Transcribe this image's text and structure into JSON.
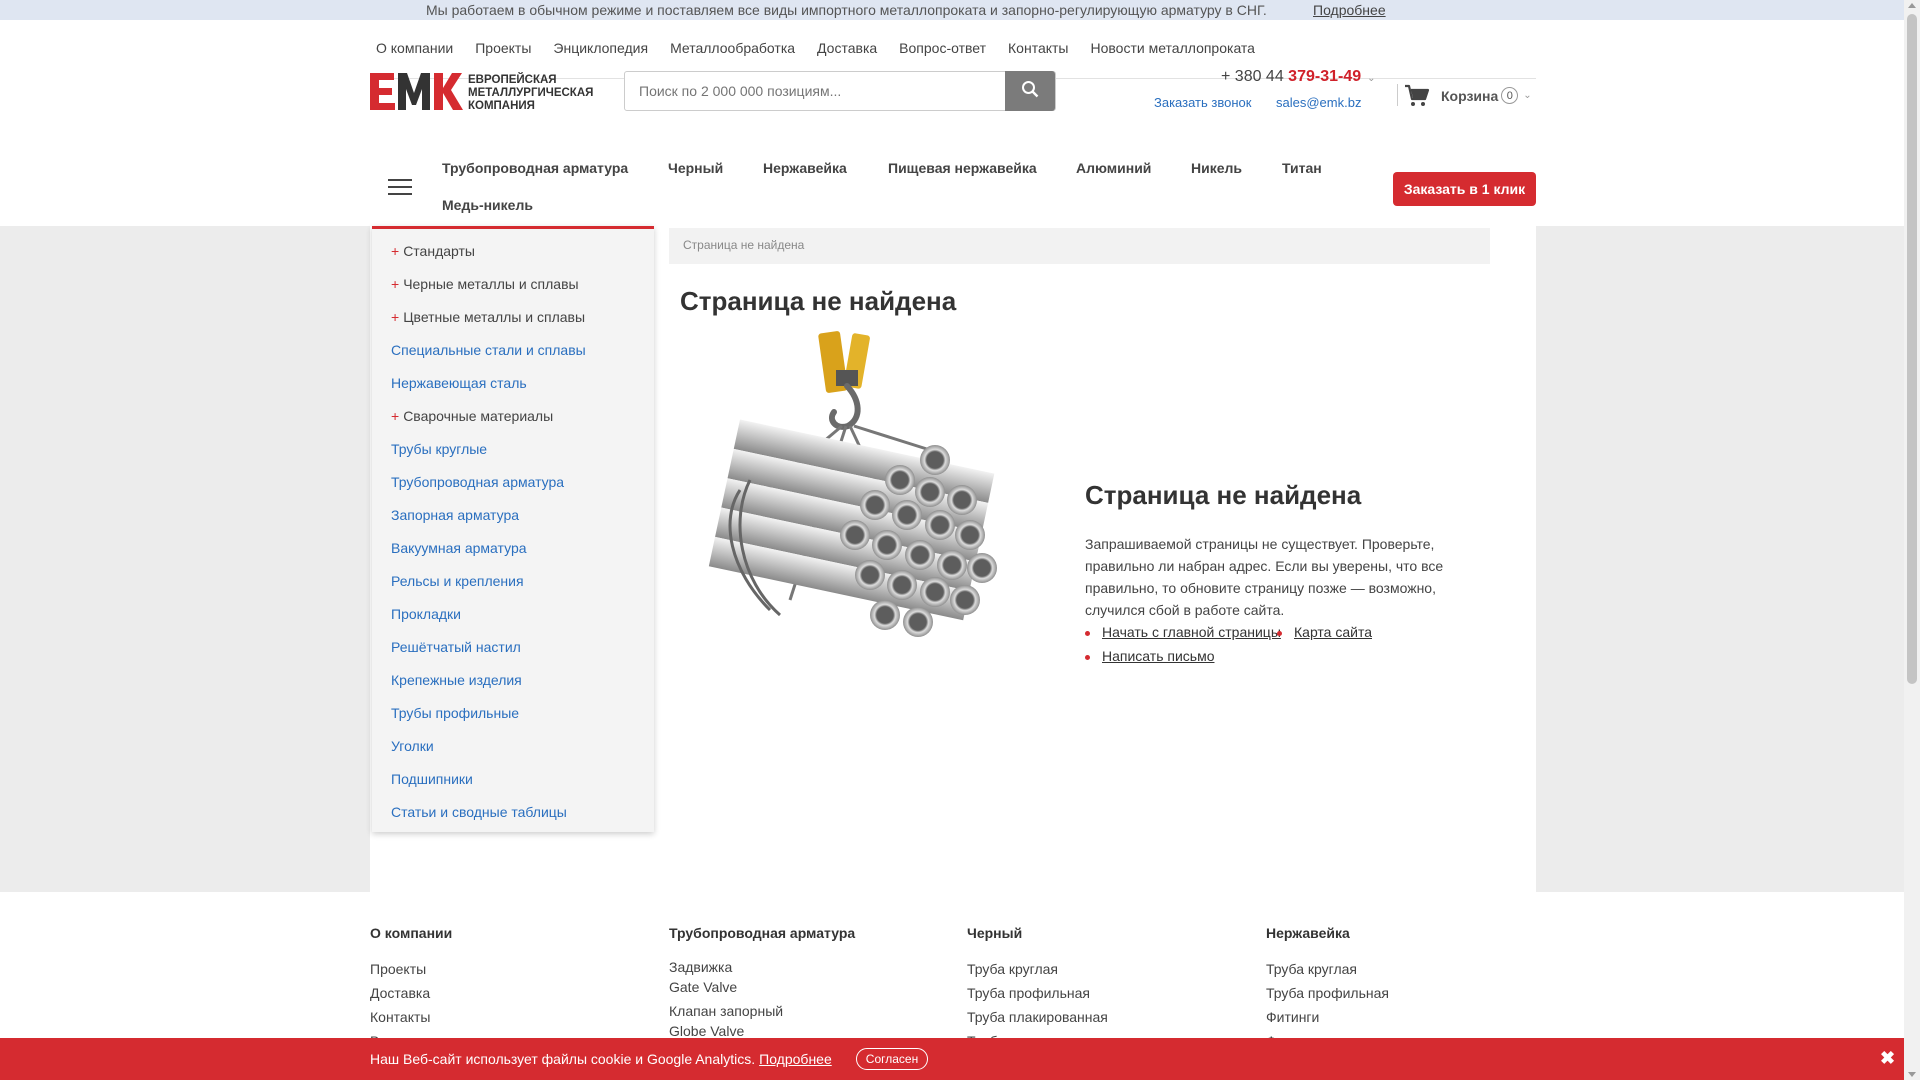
{
  "topbar": {
    "message": "Мы работаем в обычном режиме и поставляем все виды импортного металлопроката и запорно-регулирующую арматуру в СНГ.",
    "more_link": "Подробнее"
  },
  "topnav": [
    "О компании",
    "Проекты",
    "Энциклопедия",
    "Металлообработка",
    "Доставка",
    "Вопрос-ответ",
    "Контакты",
    "Новости металлопроката"
  ],
  "logo": {
    "mark": "ЕМК",
    "line1": "ЕВРОПЕЙСКАЯ",
    "line2": "МЕТАЛЛУРГИЧЕСКАЯ",
    "line3": "КОМПАНИЯ"
  },
  "search": {
    "placeholder": "Поиск по 2 000 000 позициям..."
  },
  "contact": {
    "phone_prefix": "+ 380 44 ",
    "phone_main": "379-31-49",
    "callback": "Заказать звонок",
    "email": "sales@emk.bz"
  },
  "cart": {
    "label": "Корзина",
    "count": "0"
  },
  "catnav": [
    "Трубопроводная арматура",
    "Черный",
    "Нержавейка",
    "Пищевая нержавейка",
    "Алюминий",
    "Никель",
    "Титан",
    "Медь-никель"
  ],
  "order_button": "Заказать в 1 клик",
  "sidemenu": [
    {
      "label": "Стандарты",
      "plus": true
    },
    {
      "label": "Черные металлы и сплавы",
      "plus": true
    },
    {
      "label": "Цветные металлы и сплавы",
      "plus": true
    },
    {
      "label": "Специальные стали и сплавы",
      "plus": false
    },
    {
      "label": "Нержавеющая сталь",
      "plus": false
    },
    {
      "label": "Сварочные материалы",
      "plus": true
    },
    {
      "label": "Трубы круглые",
      "plus": false
    },
    {
      "label": "Трубопроводная арматура",
      "plus": false
    },
    {
      "label": "Запорная арматура",
      "plus": false
    },
    {
      "label": "Вакуумная арматура",
      "plus": false
    },
    {
      "label": "Рельсы и крепления",
      "plus": false
    },
    {
      "label": "Прокладки",
      "plus": false
    },
    {
      "label": "Решётчатый настил",
      "plus": false
    },
    {
      "label": "Крепежные изделия",
      "plus": false
    },
    {
      "label": "Трубы профильные",
      "plus": false
    },
    {
      "label": "Уголки",
      "plus": false
    },
    {
      "label": "Подшипники",
      "plus": false
    },
    {
      "label": "Статьи и сводные таблицы",
      "plus": false
    }
  ],
  "breadcrumb": "Страница не найдена",
  "page_title": "Страница не найдена",
  "not_found": {
    "title": "Страница не найдена",
    "text": "Запрашиваемой страницы не существует. Проверьте, правильно ли набран адрес. Если вы уверены, что все правильно, то обновите страницу позже — возможно, случился сбой в работе сайта.",
    "link_home": "Начать с главной страницы",
    "link_sitemap": "Карта сайта",
    "link_write": "Написать письмо"
  },
  "footer": {
    "col1": {
      "head": "О компании",
      "items": [
        "Проекты",
        "Доставка",
        "Контакты",
        "Вакансии"
      ]
    },
    "col2": {
      "head": "Трубопроводная арматура",
      "items": [
        "Задвижка",
        "Gate Valve",
        "Клапан запорный",
        "Globe Valve"
      ]
    },
    "col3": {
      "head": "Черный",
      "items": [
        "Труба круглая",
        "Труба профильная",
        "Труба плакированная",
        "Труба в изоляции"
      ]
    },
    "col4": {
      "head": "Нержавейка",
      "items": [
        "Труба круглая",
        "Труба профильная",
        "Фитинги",
        "Фланцы"
      ]
    }
  },
  "cookie": {
    "text": "Наш Веб-сайт использует файлы cookie и Google Analytics.",
    "more": "Подробнее",
    "agree": "Согласен",
    "close": "✖"
  },
  "colors": {
    "accent": "#d52b30",
    "link": "#2a6fbf",
    "topbar_bg": "#dfe6f2"
  },
  "icons": [
    "search-icon",
    "cart-icon",
    "burger-menu-icon",
    "close-icon",
    "chevron-down-icon"
  ]
}
